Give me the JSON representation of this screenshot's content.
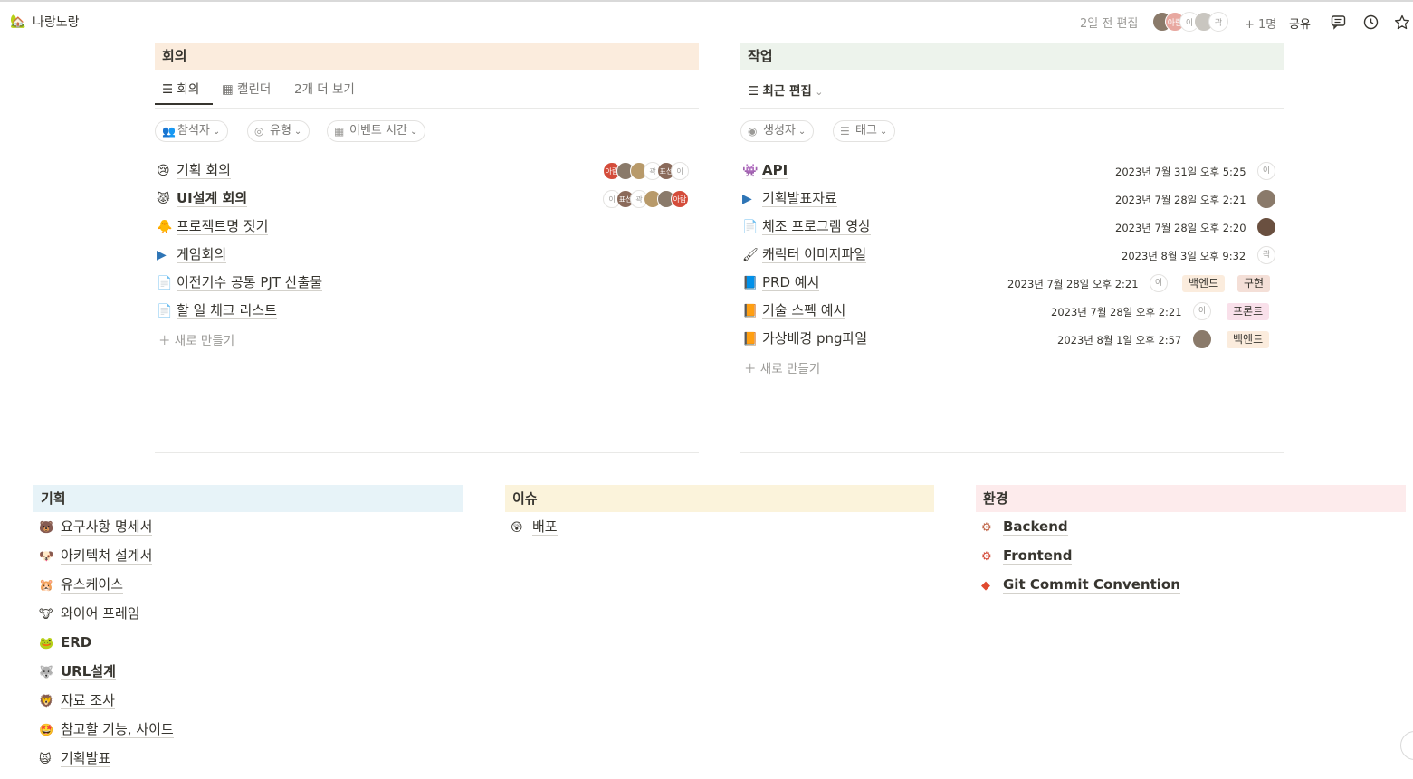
{
  "topbar": {
    "workspace_icon": "🏡",
    "workspace_title": "나랑노랑",
    "edited": "2일 전 편집",
    "avatars": [
      "",
      "아람",
      "이",
      "",
      "곽"
    ],
    "plus_count": "+ 1명",
    "share": "공유",
    "icons": [
      "comment-icon",
      "clock-icon",
      "star-icon"
    ]
  },
  "meetings": {
    "title": "회의",
    "header_color": "#fbecdd",
    "tabs": [
      {
        "icon": "list-icon",
        "label": "회의",
        "active": true
      },
      {
        "icon": "calendar-icon",
        "label": "캘린더",
        "active": false
      },
      {
        "icon": "",
        "label": "2개 더 보기",
        "active": false
      }
    ],
    "filters": [
      {
        "icon": "people-icon",
        "label": "참석자"
      },
      {
        "icon": "circle-down-icon",
        "label": "유형"
      },
      {
        "icon": "calendar-icon",
        "label": "이벤트 시간"
      }
    ],
    "rows": [
      {
        "icon": "😢",
        "title": "기획 회의",
        "avatars": [
          "아람",
          "",
          "",
          "곽",
          "표선",
          "이"
        ]
      },
      {
        "icon": "😾",
        "title": "UI설계 회의",
        "avatars": [
          "이",
          "표선",
          "곽",
          "",
          "",
          "아람"
        ]
      },
      {
        "icon": "🐥",
        "title": "프로젝트명 짓기",
        "avatars": []
      },
      {
        "icon": "▶",
        "title": "게임회의",
        "avatars": []
      },
      {
        "icon": "📄",
        "title": "이전기수 공통 PJT 산출물",
        "avatars": []
      },
      {
        "icon": "📄",
        "title": "할 일 체크 리스트",
        "avatars": []
      }
    ],
    "new_label": "새로 만들기"
  },
  "tasks": {
    "title": "작업",
    "header_color": "#edf3ec",
    "view_label": "최근 편집",
    "filters": [
      {
        "icon": "user-circle-icon",
        "label": "생성자"
      },
      {
        "icon": "list-icon",
        "label": "태그"
      }
    ],
    "rows": [
      {
        "icon": "👾",
        "title": "API",
        "bold": true,
        "date": "2023년 7월 31일 오후 5:25",
        "avatar": "이",
        "tags": []
      },
      {
        "icon": "▶",
        "title": "기획발표자료",
        "bold": false,
        "date": "2023년 7월 28일 오후 2:21",
        "avatar": "",
        "tags": []
      },
      {
        "icon": "📄",
        "title": "체조 프로그램 영상",
        "bold": false,
        "date": "2023년 7월 28일 오후 2:20",
        "avatar": "",
        "tags": []
      },
      {
        "icon": "🖌",
        "title": "캐릭터 이미지파일",
        "bold": false,
        "date": "2023년 8월 3일 오후 9:32",
        "avatar": "곽",
        "tags": []
      },
      {
        "icon": "📘",
        "title": "PRD 예시",
        "bold": false,
        "date": "2023년 7월 28일 오후 2:21",
        "avatar": "이",
        "tags": [
          {
            "label": "백엔드",
            "color": "#fbecdd"
          },
          {
            "label": "구현",
            "color": "#f4dfd7"
          }
        ]
      },
      {
        "icon": "📙",
        "title": "기술 스펙 예시",
        "bold": false,
        "date": "2023년 7월 28일 오후 2:21",
        "avatar": "이",
        "tags": [
          {
            "label": "프론트",
            "color": "#f9e0ea"
          }
        ]
      },
      {
        "icon": "📙",
        "title": "가상배경 png파일",
        "bold": false,
        "date": "2023년 8월 1일 오후 2:57",
        "avatar": "",
        "tags": [
          {
            "label": "백엔드",
            "color": "#fbecdd"
          }
        ]
      }
    ],
    "new_label": "새로 만들기"
  },
  "planning": {
    "title": "기획",
    "header_color": "#e7f3f8",
    "items": [
      {
        "icon": "🐻",
        "title": "요구사항 명세서",
        "bold": false
      },
      {
        "icon": "🐶",
        "title": "아키텍쳐 설계서",
        "bold": false
      },
      {
        "icon": "🐹",
        "title": "유스케이스",
        "bold": false
      },
      {
        "icon": "🐮",
        "title": "와이어 프레임",
        "bold": false
      },
      {
        "icon": "🐸",
        "title": "ERD",
        "bold": true
      },
      {
        "icon": "🐺",
        "title": "URL설계",
        "bold": true
      },
      {
        "icon": "🦁",
        "title": "자료 조사",
        "bold": false
      },
      {
        "icon": "🤩",
        "title": "참고할 기능, 사이트",
        "bold": false
      },
      {
        "icon": "🙀",
        "title": "기획발표",
        "bold": false
      }
    ]
  },
  "issues": {
    "title": "이슈",
    "header_color": "#fbf3db",
    "items": [
      {
        "icon": "😲",
        "title": "배포",
        "bold": false
      }
    ]
  },
  "env": {
    "title": "환경",
    "header_color": "#fdebec",
    "items": [
      {
        "icon": "⚙",
        "title": "Backend",
        "bold": true
      },
      {
        "icon": "⚙",
        "title": "Frontend",
        "bold": true
      },
      {
        "icon": "◆",
        "title": "Git Commit Convention",
        "bold": true
      }
    ]
  }
}
